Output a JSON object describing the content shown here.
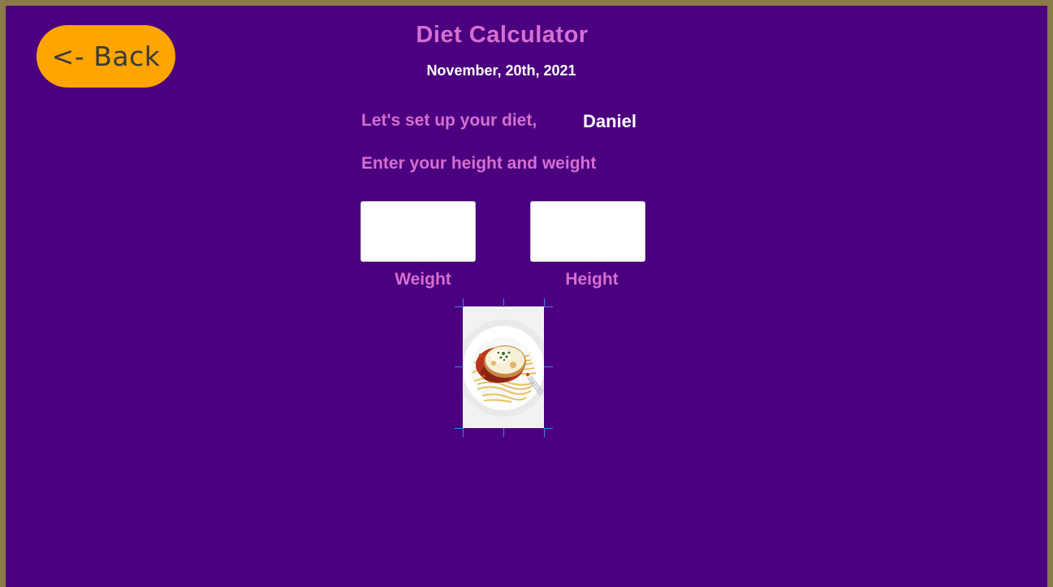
{
  "header": {
    "back_label": "<- Back",
    "title": "Diet Calculator",
    "date": "November, 20th, 2021"
  },
  "greeting": {
    "prefix": "Let's set up your diet,",
    "user_name": "Daniel"
  },
  "instruction": "Enter your height and weight",
  "form": {
    "weight": {
      "label": "Weight",
      "value": ""
    },
    "height": {
      "label": "Height",
      "value": ""
    }
  },
  "image": {
    "icon": "pasta-dish-photo"
  },
  "colors": {
    "background": "#4b0080",
    "border": "#8a7a4a",
    "accent": "#d66fd0",
    "back_button": "#ffa500",
    "selection_handles": "#3b82f6"
  }
}
